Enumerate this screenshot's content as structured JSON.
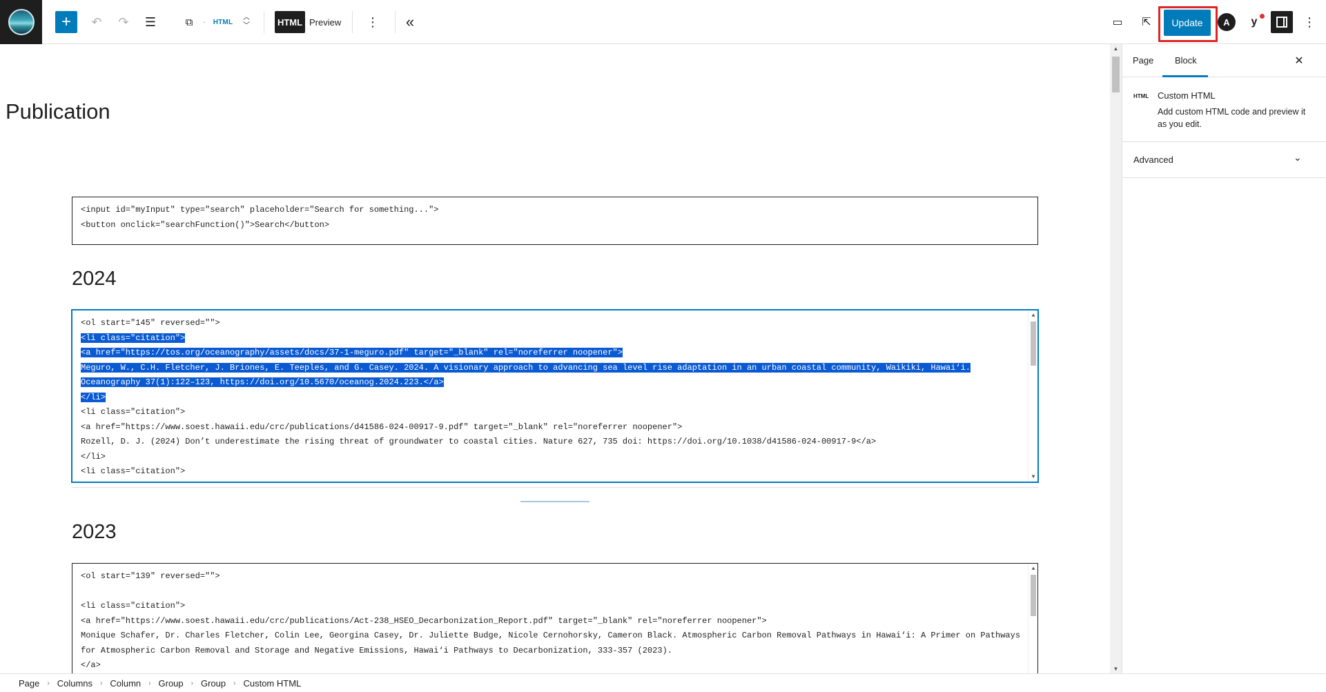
{
  "toolbar": {
    "add_icon": "+",
    "undo_icon": "↶",
    "redo_icon": "↷",
    "outline_icon": "☰",
    "block_type_label": "HTML",
    "mode_html": "HTML",
    "mode_preview": "Preview",
    "more_icon": "⋮",
    "collapse_icon": "«",
    "update_label": "Update",
    "circle_a_label": "A",
    "yoast_label": "y",
    "options_icon": "⋮",
    "accent_color": "#007cba",
    "highlight_color": "#e02424"
  },
  "page": {
    "title": "Publication"
  },
  "search_block": {
    "lines": [
      "<input id=\"myInput\" type=\"search\" placeholder=\"Search for something...\">",
      "<button onclick=\"searchFunction()\">Search</button>"
    ]
  },
  "section_2024": {
    "heading": "2024",
    "lines": [
      "<ol start=\"145\" reversed=\"\">",
      "<li class=\"citation\">",
      "<a href=\"https://tos.org/oceanography/assets/docs/37-1-meguro.pdf\" target=\"_blank\" rel=\"noreferrer noopener\">",
      "Meguro, W., C.H. Fletcher, J. Briones, E. Teeples, and G. Casey. 2024. A visionary approach to advancing sea level rise adaptation in an urban coastal community, Waikiki, Hawai‘i.",
      "Oceanography 37(1):122–123, https://doi.org/10.5670/oceanog.2024.223.</a>",
      "</li>",
      "<li class=\"citation\">",
      "<a href=\"https://www.soest.hawaii.edu/crc/publications/d41586-024-00917-9.pdf\" target=\"_blank\" rel=\"noreferrer noopener\">",
      "Rozell, D. J. (2024) Don’t underestimate the rising threat of groundwater to coastal cities. Nature 627, 735 doi: https://doi.org/10.1038/d41586-024-00917-9</a>",
      "</li>",
      "<li class=\"citation\">"
    ]
  },
  "section_2023": {
    "heading": "2023",
    "lines": [
      "<ol start=\"139\" reversed=\"\">",
      "",
      "<li class=\"citation\">",
      "<a href=\"https://www.soest.hawaii.edu/crc/publications/Act-238_HSEO_Decarbonization_Report.pdf\" target=\"_blank\" rel=\"noreferrer noopener\">",
      "Monique Schafer, Dr. Charles Fletcher, Colin Lee, Georgina Casey, Dr. Juliette Budge, Nicole Cernohorsky, Cameron Black. Atmospheric Carbon Removal Pathways in Hawai‘i: A Primer on Pathways",
      "for Atmospheric Carbon Removal and Storage and Negative Emissions, Hawai‘i Pathways to Decarbonization, 333-357 (2023).",
      "</a>"
    ]
  },
  "sidebar": {
    "tab_page": "Page",
    "tab_block": "Block",
    "close_icon": "✕",
    "block_icon": "HTML",
    "block_title": "Custom HTML",
    "block_desc": "Add custom HTML code and preview it as you edit.",
    "advanced_label": "Advanced",
    "chevron_icon": "⌄"
  },
  "breadcrumb": [
    "Page",
    "Columns",
    "Column",
    "Group",
    "Group",
    "Custom HTML"
  ],
  "breadcrumb_sep": "›"
}
